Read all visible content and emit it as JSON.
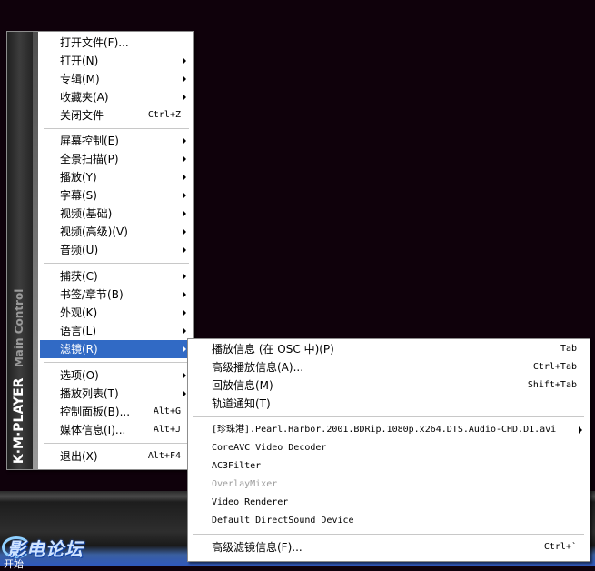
{
  "main_menu": {
    "brand": "K·M·PLAYER",
    "subtitle": "Main Control",
    "items": [
      {
        "label": "打开文件(F)...",
        "shortcut": ""
      },
      {
        "label": "打开(N)",
        "shortcut": ""
      },
      {
        "label": "专辑(M)",
        "shortcut": ""
      },
      {
        "label": "收藏夹(A)",
        "shortcut": ""
      },
      {
        "label": "关闭文件",
        "shortcut": "Ctrl+Z"
      },
      {
        "label": "屏幕控制(E)",
        "shortcut": ""
      },
      {
        "label": "全景扫描(P)",
        "shortcut": ""
      },
      {
        "label": "播放(Y)",
        "shortcut": ""
      },
      {
        "label": "字幕(S)",
        "shortcut": ""
      },
      {
        "label": "视频(基础)",
        "shortcut": ""
      },
      {
        "label": "视频(高级)(V)",
        "shortcut": ""
      },
      {
        "label": "音频(U)",
        "shortcut": ""
      },
      {
        "label": "捕获(C)",
        "shortcut": ""
      },
      {
        "label": "书签/章节(B)",
        "shortcut": ""
      },
      {
        "label": "外观(K)",
        "shortcut": ""
      },
      {
        "label": "语言(L)",
        "shortcut": ""
      },
      {
        "label": "滤镜(R)",
        "shortcut": ""
      },
      {
        "label": "选项(O)",
        "shortcut": ""
      },
      {
        "label": "播放列表(T)",
        "shortcut": ""
      },
      {
        "label": "控制面板(B)...",
        "shortcut": "Alt+G"
      },
      {
        "label": "媒体信息(I)...",
        "shortcut": "Alt+J"
      },
      {
        "label": "退出(X)",
        "shortcut": "Alt+F4"
      }
    ]
  },
  "filter_submenu": {
    "items": [
      {
        "label": "播放信息 (在 OSC 中)(P)",
        "shortcut": "Tab"
      },
      {
        "label": "高级播放信息(A)...",
        "shortcut": "Ctrl+Tab"
      },
      {
        "label": "回放信息(M)",
        "shortcut": "Shift+Tab"
      },
      {
        "label": "轨道通知(T)",
        "shortcut": ""
      },
      {
        "label": "[珍珠港].Pearl.Harbor.2001.BDRip.1080p.x264.DTS.Audio-CHD.D1.avi",
        "shortcut": ""
      },
      {
        "label": "CoreAVC Video Decoder",
        "shortcut": ""
      },
      {
        "label": "AC3Filter",
        "shortcut": ""
      },
      {
        "label": "OverlayMixer",
        "shortcut": ""
      },
      {
        "label": "Video Renderer",
        "shortcut": ""
      },
      {
        "label": "Default DirectSound Device",
        "shortcut": ""
      },
      {
        "label": "高级滤镜信息(F)...",
        "shortcut": "Ctrl+`"
      }
    ]
  },
  "watermark": "影电论坛",
  "taskbar": {
    "start_label": "开始"
  },
  "colors": {
    "highlight": "#316ac5",
    "background": "#0f010b",
    "disabled_text": "#9d9d9d"
  }
}
